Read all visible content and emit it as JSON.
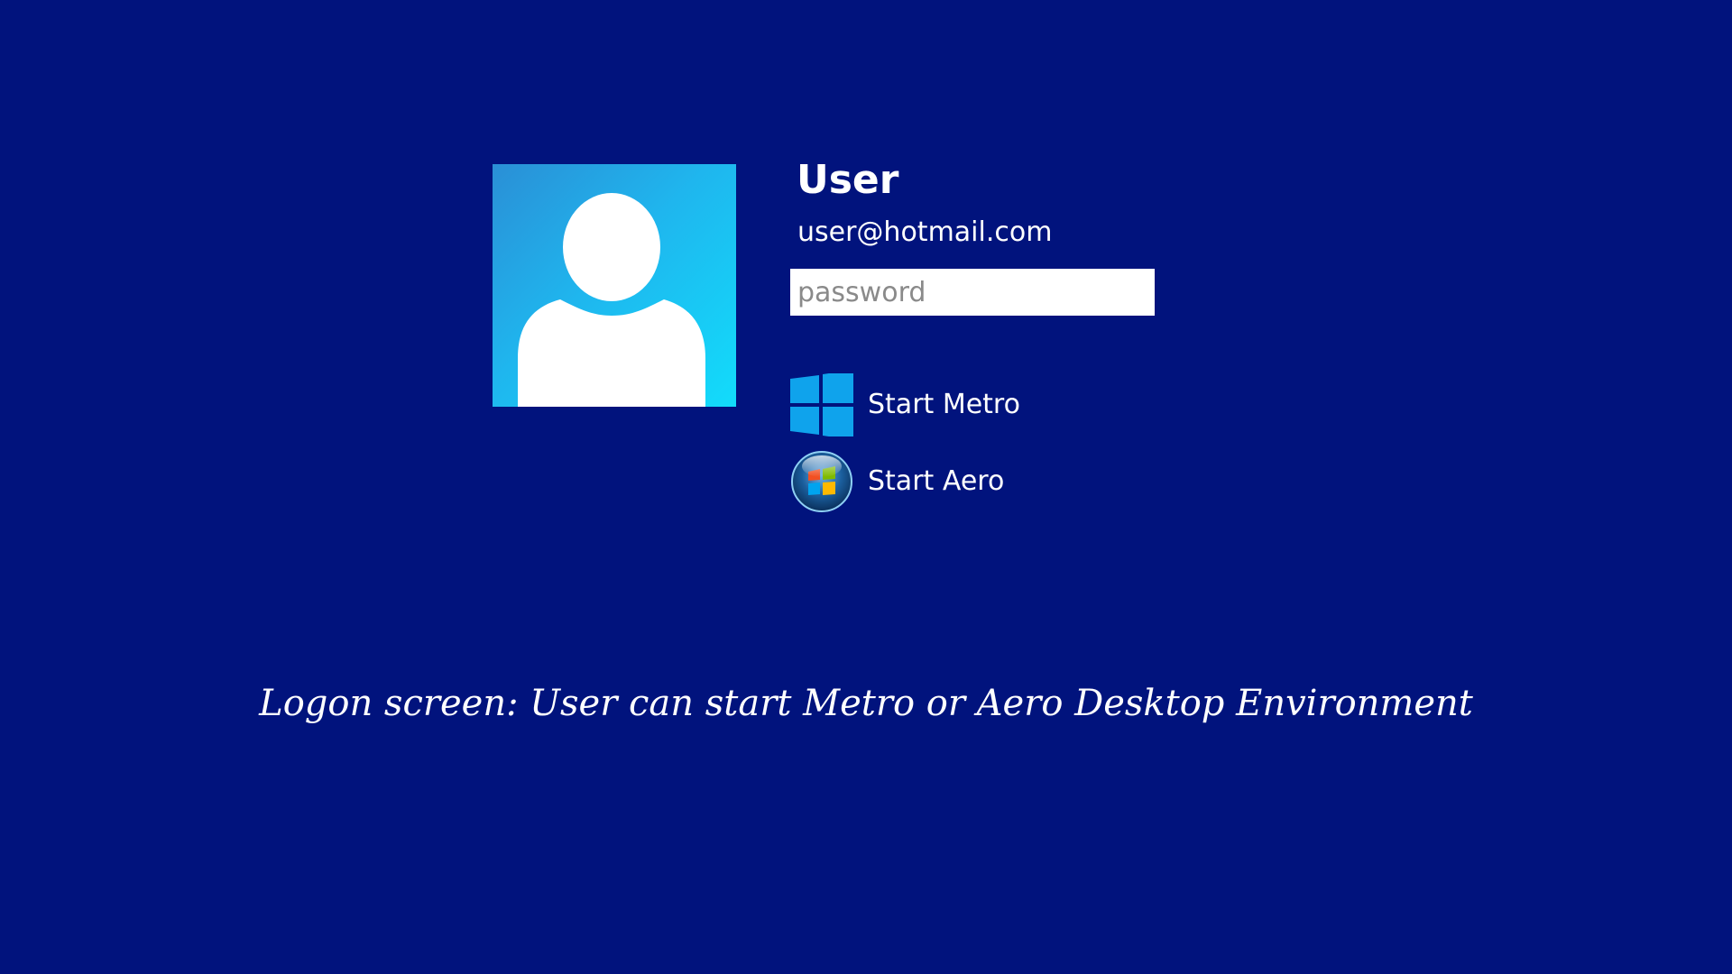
{
  "account": {
    "avatar_icon": "user-silhouette-icon",
    "name": "User",
    "email": "user@hotmail.com"
  },
  "password": {
    "value": "",
    "placeholder": "password"
  },
  "options": [
    {
      "label": "Start Metro",
      "icon": "windows-metro-logo-icon"
    },
    {
      "label": "Start Aero",
      "icon": "windows-aero-orb-icon"
    }
  ],
  "caption": "Logon screen: User can start Metro or Aero Desktop Environment",
  "colors": {
    "background": "#01137d",
    "avatar_gradient_start": "#2a8fd6",
    "avatar_gradient_end": "#12dcfb",
    "metro_logo": "#0fa3ec",
    "text": "#ffffff",
    "input_background": "#ffffff"
  }
}
